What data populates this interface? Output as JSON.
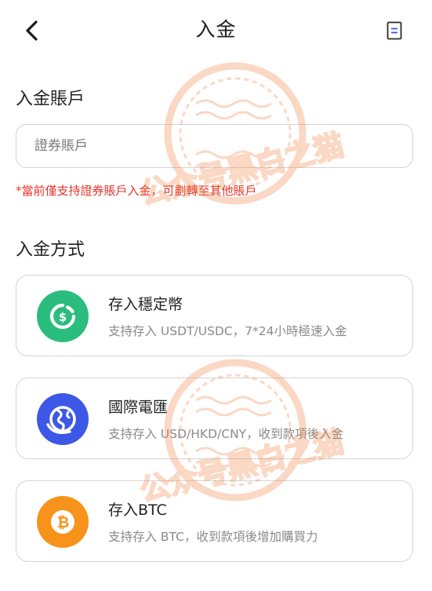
{
  "header": {
    "title": "入金",
    "back_icon": "chevron-left-icon",
    "doc_icon": "document-icon"
  },
  "account_section": {
    "title": "入金賬戶",
    "input_placeholder": "證券賬戶",
    "notice": "*當前僅支持證券賬戶入金，可劃轉至其他賬戶"
  },
  "method_section": {
    "title": "入金方式",
    "methods": [
      {
        "title": "存入穩定幣",
        "desc": "支持存入 USDT/USDC，7*24小時極速入金",
        "icon": "stablecoin-icon",
        "color": "#2bbd7e"
      },
      {
        "title": "國際電匯",
        "desc": "支持存入 USD/HKD/CNY，收到款項後入金",
        "icon": "globe-wire-icon",
        "color": "#3d57e6"
      },
      {
        "title": "存入BTC",
        "desc": "支持存入 BTC，收到款項後增加購買力",
        "icon": "bitcoin-icon",
        "color": "#f7931a"
      }
    ]
  },
  "watermark": {
    "text": "公众号黑白之猫"
  },
  "colors": {
    "accent_blue": "#3d57e6",
    "notice_red": "#e0342c",
    "watermark_orange": "#f2884b"
  }
}
